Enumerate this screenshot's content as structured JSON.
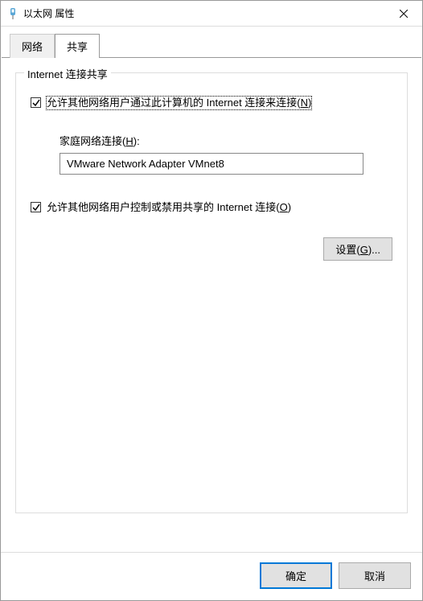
{
  "window": {
    "title": "以太网 属性"
  },
  "tabs": {
    "network": "网络",
    "sharing": "共享"
  },
  "group": {
    "title": "Internet 连接共享",
    "allow_connect_pre": "允许其他网络用户通过此计算机的 Internet 连接来连接(",
    "allow_connect_key": "N",
    "allow_connect_post": ")",
    "home_conn_label_pre": "家庭网络连接(",
    "home_conn_label_key": "H",
    "home_conn_label_post": "):",
    "home_conn_value": "VMware Network Adapter VMnet8",
    "allow_control_pre": "允许其他网络用户控制或禁用共享的 Internet 连接(",
    "allow_control_key": "O",
    "allow_control_post": ")",
    "settings_pre": "设置(",
    "settings_key": "G",
    "settings_post": ")..."
  },
  "footer": {
    "ok": "确定",
    "cancel": "取消"
  }
}
